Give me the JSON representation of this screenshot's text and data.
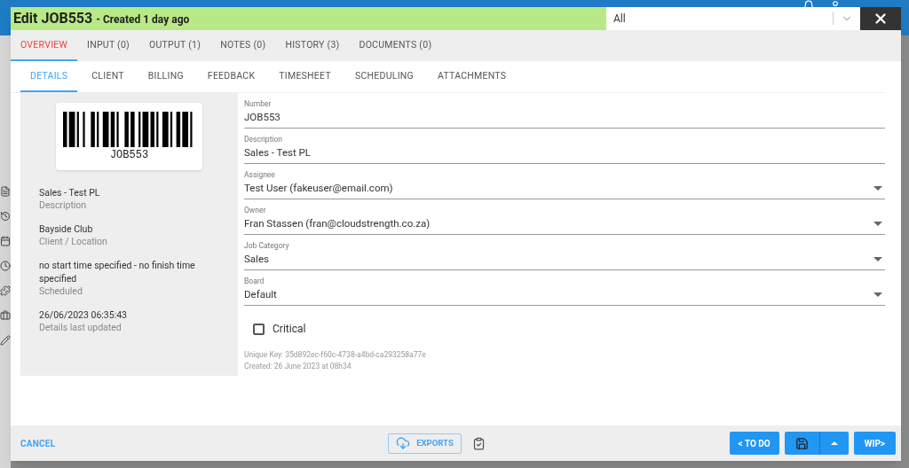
{
  "modal": {
    "title": "Edit JOB553",
    "subtitle": "- Created 1 day ago",
    "filter": {
      "value": "All"
    }
  },
  "tabs": [
    {
      "label": "OVERVIEW",
      "selected": true
    },
    {
      "label": "INPUT (0)",
      "selected": false
    },
    {
      "label": "OUTPUT (1)",
      "selected": false
    },
    {
      "label": "NOTES (0)",
      "selected": false
    },
    {
      "label": "HISTORY (3)",
      "selected": false
    },
    {
      "label": "DOCUMENTS (0)",
      "selected": false
    }
  ],
  "subtabs": [
    {
      "label": "DETAILS",
      "selected": true
    },
    {
      "label": "CLIENT",
      "selected": false
    },
    {
      "label": "BILLING",
      "selected": false
    },
    {
      "label": "FEEDBACK",
      "selected": false
    },
    {
      "label": "TIMESHEET",
      "selected": false
    },
    {
      "label": "SCHEDULING",
      "selected": false
    },
    {
      "label": "ATTACHMENTS",
      "selected": false
    }
  ],
  "summary": {
    "barcode": "JOB553",
    "items": [
      {
        "value": "Sales - Test PL",
        "caption": "Description"
      },
      {
        "value": "Bayside Club",
        "caption": "Client / Location"
      },
      {
        "value": "no start time specified - no finish time specified",
        "caption": "Scheduled"
      },
      {
        "value": "26/06/2023 06:35:43",
        "caption": "Details last updated"
      }
    ]
  },
  "fields": [
    {
      "label": "Number",
      "value": "JOB553",
      "kind": "text"
    },
    {
      "label": "Description",
      "value": "Sales - Test PL",
      "kind": "text"
    },
    {
      "label": "Assignee",
      "value": "Test User (fakeuser@email.com)",
      "kind": "select"
    },
    {
      "label": "Owner",
      "value": "Fran Stassen (fran@cloudstrength.co.za)",
      "kind": "select"
    },
    {
      "label": "Job Category",
      "value": "Sales",
      "kind": "select"
    },
    {
      "label": "Board",
      "value": "Default",
      "kind": "select"
    }
  ],
  "critical": {
    "label": "Critical",
    "checked": false
  },
  "meta": [
    "Unique Key: 35d892ec-f60c-4738-a4bd-ca293258a77e",
    "Created: 26 June 2023 at 08h34"
  ],
  "footer": {
    "cancel": "CANCEL",
    "exports": "EXPORTS",
    "prev": "< TO DO",
    "next": "WIP>"
  }
}
